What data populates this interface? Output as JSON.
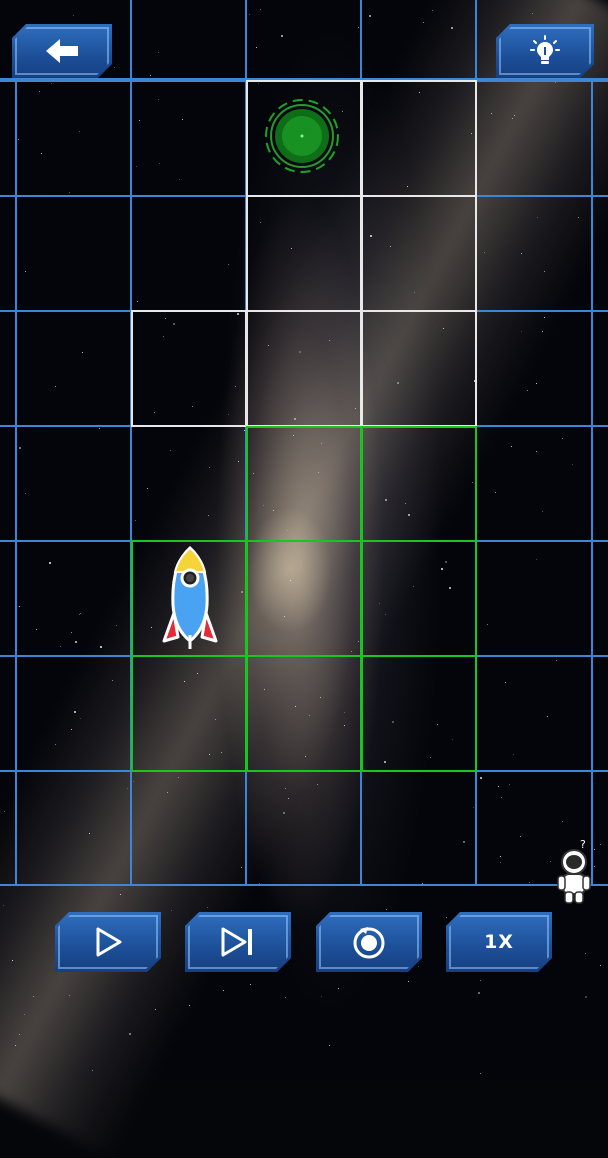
{
  "toolbar": {
    "back_icon": "arrow-left-icon",
    "hint_icon": "lightbulb-icon"
  },
  "board": {
    "columns": 5,
    "rows": 7,
    "rocket_icon": "rocket-icon",
    "target_icon": "green-portal-icon",
    "helper_icon": "astronaut-icon"
  },
  "controls": {
    "play_icon": "play-icon",
    "step_icon": "step-forward-icon",
    "reset_icon": "reset-icon",
    "speed_label": "1X"
  },
  "colors": {
    "grid_blue": "#3d86d6",
    "path_white": "#e8e8e8",
    "path_green": "#19c61f",
    "button_blue": "#1d4f98"
  }
}
